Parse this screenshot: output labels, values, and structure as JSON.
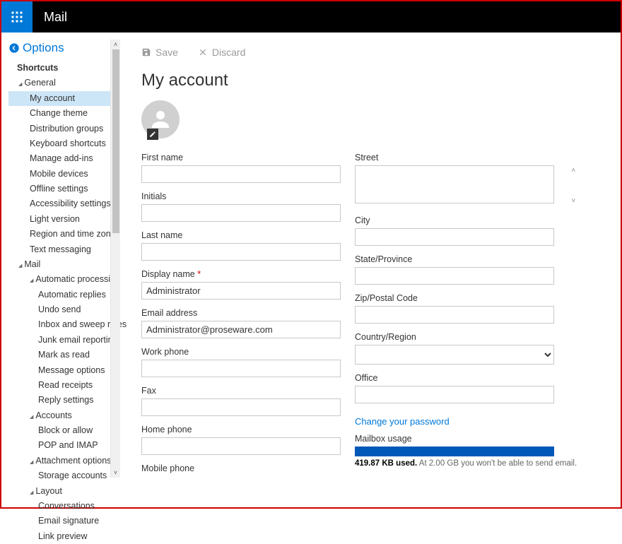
{
  "header": {
    "app": "Mail"
  },
  "options": {
    "title": "Options"
  },
  "sidebar": {
    "shortcuts": "Shortcuts",
    "general": {
      "label": "General",
      "items": [
        "My account",
        "Change theme",
        "Distribution groups",
        "Keyboard shortcuts",
        "Manage add-ins",
        "Mobile devices",
        "Offline settings",
        "Accessibility settings",
        "Light version",
        "Region and time zone",
        "Text messaging"
      ]
    },
    "mail": {
      "label": "Mail",
      "auto": {
        "label": "Automatic processing",
        "items": [
          "Automatic replies",
          "Undo send",
          "Inbox and sweep rules",
          "Junk email reporting",
          "Mark as read",
          "Message options",
          "Read receipts",
          "Reply settings"
        ]
      },
      "accounts": {
        "label": "Accounts",
        "items": [
          "Block or allow",
          "POP and IMAP"
        ]
      },
      "attach": {
        "label": "Attachment options",
        "items": [
          "Storage accounts"
        ]
      },
      "layout": {
        "label": "Layout",
        "items": [
          "Conversations",
          "Email signature",
          "Link preview"
        ]
      }
    }
  },
  "toolbar": {
    "save": "Save",
    "discard": "Discard"
  },
  "page": {
    "title": "My account"
  },
  "fields": {
    "first_name": {
      "label": "First name",
      "value": ""
    },
    "initials": {
      "label": "Initials",
      "value": ""
    },
    "last_name": {
      "label": "Last name",
      "value": ""
    },
    "display_name": {
      "label": "Display name",
      "value": "Administrator"
    },
    "email": {
      "label": "Email address",
      "value": "Administrator@proseware.com"
    },
    "work_phone": {
      "label": "Work phone",
      "value": ""
    },
    "fax": {
      "label": "Fax",
      "value": ""
    },
    "home_phone": {
      "label": "Home phone",
      "value": ""
    },
    "mobile_phone": {
      "label": "Mobile phone",
      "value": ""
    },
    "street": {
      "label": "Street",
      "value": ""
    },
    "city": {
      "label": "City",
      "value": ""
    },
    "state": {
      "label": "State/Province",
      "value": ""
    },
    "zip": {
      "label": "Zip/Postal Code",
      "value": ""
    },
    "country": {
      "label": "Country/Region",
      "value": ""
    },
    "office": {
      "label": "Office",
      "value": ""
    }
  },
  "links": {
    "change_pw": "Change your password"
  },
  "usage": {
    "label": "Mailbox usage",
    "used_bold": "419.87 KB used.",
    "rest": "  At 2.00 GB you won't be able to send email."
  }
}
